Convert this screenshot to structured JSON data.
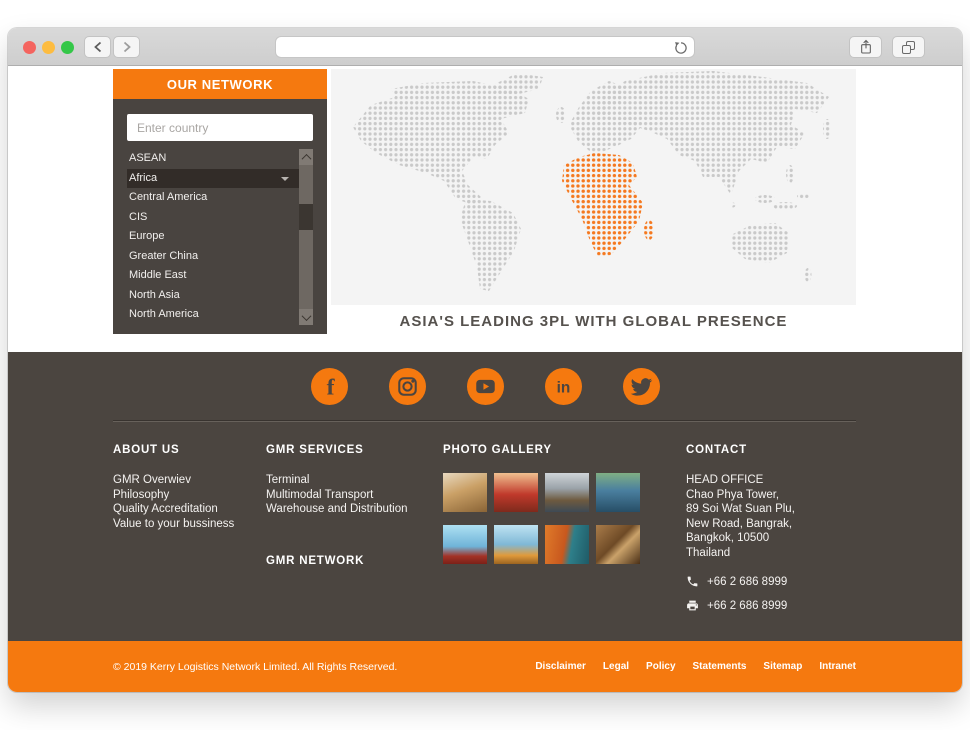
{
  "browser": {
    "url_value": "",
    "icons": [
      "close-icon",
      "minimize-icon",
      "zoom-icon",
      "back-icon",
      "forward-icon",
      "reload-icon",
      "share-icon",
      "tabs-icon"
    ]
  },
  "network_panel": {
    "title": "OUR NETWORK",
    "search_placeholder": "Enter country",
    "regions": [
      "ASEAN",
      "Africa",
      "Central America",
      "CIS",
      "Europe",
      "Greater China",
      "Middle East",
      "North Asia",
      "North America"
    ],
    "selected_region": "Africa"
  },
  "map": {
    "caption": "ASIA'S LEADING 3PL WITH GLOBAL PRESENCE",
    "highlighted_region": "Africa",
    "dot_color": "#C9C9C9",
    "highlight_color": "#F5781E",
    "background_color": "#F4F4F4"
  },
  "social": {
    "icons": [
      "facebook-icon",
      "instagram-icon",
      "youtube-icon",
      "linkedin-icon",
      "twitter-icon"
    ]
  },
  "footer": {
    "about": {
      "title": "ABOUT US",
      "links": [
        "GMR Overwiev",
        "Philosophy",
        "Quality Accreditation",
        "Value to your bussiness"
      ]
    },
    "services": {
      "title": "GMR SERVICES",
      "links": [
        "Terminal",
        "Multimodal Transport",
        "Warehouse and Distribution"
      ],
      "network_title": "GMR NETWORK"
    },
    "gallery": {
      "title": "PHOTO GALLERY",
      "photo_count": 8
    },
    "contact": {
      "title": "CONTACT",
      "office": "HEAD OFFICE",
      "address_lines": [
        "Chao Phya Tower,",
        "89 Soi Wat Suan Plu,",
        "New Road, Bangrak,",
        "Bangkok, 10500",
        "Thailand"
      ],
      "phone": "+66 2 686 8999",
      "fax": "+66 2 686 8999"
    }
  },
  "bottom_bar": {
    "copyright": "© 2019 Kerry Logistics Network Limited. All Rights Reserved.",
    "links": [
      "Disclaimer",
      "Legal",
      "Policy",
      "Statements",
      "Sitemap",
      "Intranet"
    ]
  },
  "colors": {
    "orange": "#F5790F",
    "footer_background": "#4B4540",
    "panel_background": "#494440",
    "selected_row": "#322C28"
  }
}
